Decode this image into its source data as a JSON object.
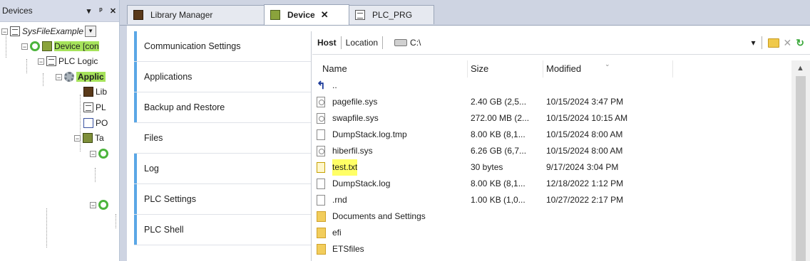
{
  "devices_panel": {
    "title": "Devices",
    "pin_icon": "pin-icon",
    "close_icon": "close-icon",
    "tree": {
      "project": "SysFileExample",
      "device": "Device [con",
      "plc_logic": "PLC Logic",
      "application": "Applic",
      "lib": "Lib",
      "plc": "PL",
      "pou": "PO",
      "task": "Ta"
    }
  },
  "tabs": [
    {
      "label": "Library Manager",
      "icon": "library-icon",
      "active": false
    },
    {
      "label": "Device",
      "icon": "device-icon",
      "active": true,
      "close": "✕"
    },
    {
      "label": "PLC_PRG",
      "icon": "document-icon",
      "active": false
    }
  ],
  "nav": {
    "items": [
      {
        "label": "Communication Settings"
      },
      {
        "label": "Applications"
      },
      {
        "label": "Backup and Restore"
      },
      {
        "label": "Files",
        "selected": true
      },
      {
        "label": "Log"
      },
      {
        "label": "PLC Settings"
      },
      {
        "label": "PLC Shell"
      }
    ]
  },
  "pathbar": {
    "host": "Host",
    "location": "Location",
    "path": "C:\\",
    "dropdown": "▾"
  },
  "file_table": {
    "headers": {
      "name": "Name",
      "size": "Size",
      "modified": "Modified"
    },
    "rows": [
      {
        "name": "..",
        "size": "",
        "modified": "",
        "icon": "up-icon"
      },
      {
        "name": "pagefile.sys",
        "size": "2.40 GB (2,5...",
        "modified": "10/15/2024 3:47 PM",
        "icon": "sys-file-icon"
      },
      {
        "name": "swapfile.sys",
        "size": "272.00 MB (2...",
        "modified": "10/15/2024 10:15 AM",
        "icon": "sys-file-icon"
      },
      {
        "name": "DumpStack.log.tmp",
        "size": "8.00 KB (8,1...",
        "modified": "10/15/2024 8:00 AM",
        "icon": "file-icon"
      },
      {
        "name": "hiberfil.sys",
        "size": "6.26 GB (6,7...",
        "modified": "10/15/2024 8:00 AM",
        "icon": "sys-file-icon"
      },
      {
        "name": "test.txt",
        "size": "30 bytes",
        "modified": "9/17/2024 3:04 PM",
        "icon": "text-file-icon",
        "highlight": true
      },
      {
        "name": "DumpStack.log",
        "size": "8.00 KB (8,1...",
        "modified": "12/18/2022 1:12 PM",
        "icon": "text-file-icon"
      },
      {
        "name": ".rnd",
        "size": "1.00 KB (1,0...",
        "modified": "10/27/2022 2:17 PM",
        "icon": "file-icon"
      },
      {
        "name": "Documents and Settings",
        "size": "",
        "modified": "",
        "icon": "shortcut-folder-icon"
      },
      {
        "name": "efi",
        "size": "",
        "modified": "",
        "icon": "folder-icon"
      },
      {
        "name": "ETSfiles",
        "size": "",
        "modified": "",
        "icon": "folder-icon"
      }
    ]
  },
  "colors": {
    "panel_bg": "#d6dbe9",
    "tab_bg": "#ced4e2",
    "nav_accent": "#5aa7e6",
    "highlight": "#ffff66",
    "tree_highlight": "#a6e35b"
  }
}
